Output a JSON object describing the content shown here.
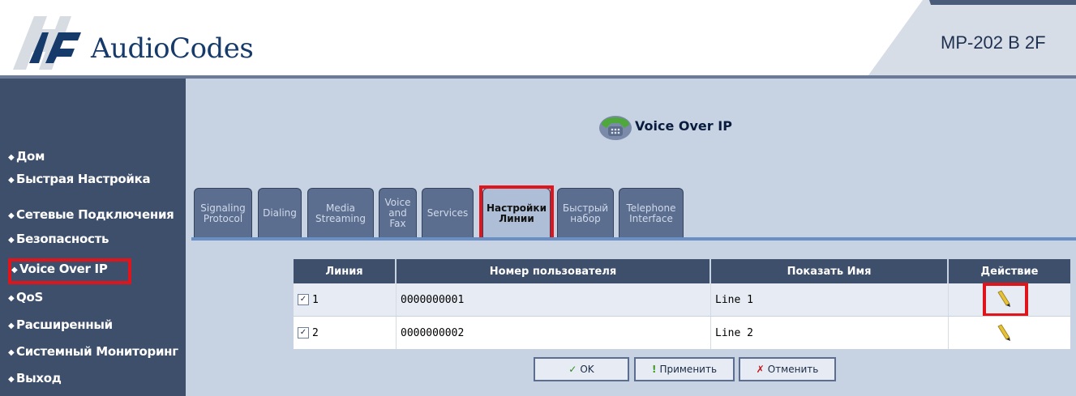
{
  "header": {
    "brand": "AudioCodes",
    "model": "MP-202 B 2F"
  },
  "sidebar": {
    "items": [
      {
        "label": "Дом"
      },
      {
        "label": "Быстрая Настройка"
      },
      {
        "label": "Сетевые Подключения"
      },
      {
        "label": "Безопасность"
      },
      {
        "label": "Voice Over IP",
        "active": true
      },
      {
        "label": "QoS"
      },
      {
        "label": "Расширенный"
      },
      {
        "label": "Системный Мониторинг"
      },
      {
        "label": "Выход"
      }
    ]
  },
  "page": {
    "title": "Voice Over IP",
    "icon": "telephone-icon"
  },
  "tabs": [
    {
      "line1": "Signaling",
      "line2": "Protocol"
    },
    {
      "line1": "Dialing",
      "line2": ""
    },
    {
      "line1": "Media",
      "line2": "Streaming"
    },
    {
      "line1": "Voice",
      "line2": "and",
      "line3": "Fax"
    },
    {
      "line1": "Services",
      "line2": ""
    },
    {
      "line1": "Настройки",
      "line2": "Линии",
      "active": true
    },
    {
      "line1": "Быстрый",
      "line2": "набор"
    },
    {
      "line1": "Telephone",
      "line2": "Interface"
    }
  ],
  "table": {
    "headers": [
      "Линия",
      "Номер пользователя",
      "Показать Имя",
      "Действие"
    ],
    "rows": [
      {
        "line": "1",
        "checked": true,
        "user_number": "0000000001",
        "display_name": "Line 1",
        "action_icon": "pencil-icon"
      },
      {
        "line": "2",
        "checked": true,
        "user_number": "0000000002",
        "display_name": "Line 2",
        "action_icon": "pencil-icon"
      }
    ]
  },
  "buttons": {
    "ok": "OK",
    "apply": "Применить",
    "cancel": "Отменить"
  },
  "colors": {
    "sidebar_bg": "#3e4f6b",
    "main_bg": "#c7d3e3",
    "highlight": "#e0151b",
    "tab_bg": "#5c6e8f"
  },
  "symbols": {
    "check": "✓",
    "x": "✗",
    "excl": "!",
    "bullet": "◆",
    "checkmark_box": "✓"
  }
}
